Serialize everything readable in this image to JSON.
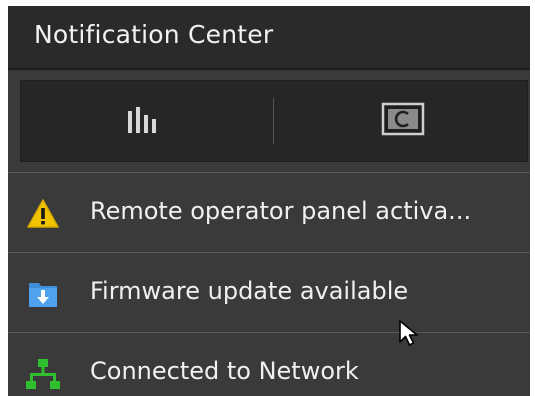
{
  "header": {
    "title": "Notification Center"
  },
  "toolbar": {
    "buttons": [
      {
        "icon": "bar-chart-icon"
      },
      {
        "icon": "screen-refresh-icon"
      }
    ]
  },
  "notifications": [
    {
      "icon": "warning-icon",
      "label": "Remote operator panel activa..."
    },
    {
      "icon": "download-folder-icon",
      "label": "Firmware update available"
    },
    {
      "icon": "network-icon",
      "label": "Connected to Network"
    }
  ],
  "colors": {
    "warning": "#f2c400",
    "folder": "#3f8fd8",
    "network": "#2fbf2f"
  }
}
